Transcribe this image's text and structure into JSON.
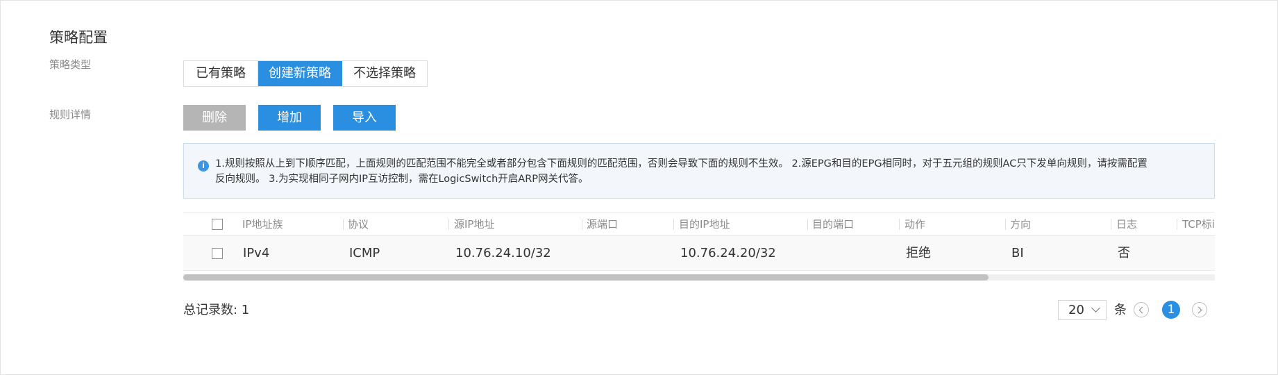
{
  "section_title": "策略配置",
  "policy_type": {
    "label": "策略类型",
    "options": [
      "已有策略",
      "创建新策略",
      "不选择策略"
    ],
    "selected": "创建新策略"
  },
  "rule_details": {
    "label": "规则详情",
    "buttons": {
      "delete": "删除",
      "add": "增加",
      "import": "导入"
    }
  },
  "notice": {
    "icon": "info-icon",
    "line1": "1.规则按照从上到下顺序匹配，上面规则的匹配范围不能完全或者部分包含下面规则的匹配范围，否则会导致下面的规则不生效。 2.源EPG和目的EPG相同时，对于五元组的规则AC只下发单向规则，请按需配置",
    "line2": "反向规则。 3.为实现相同子网内IP互访控制，需在LogicSwitch开启ARP网关代答。"
  },
  "table": {
    "columns": [
      "IP地址族",
      "协议",
      "源IP地址",
      "源端口",
      "目的IP地址",
      "目的端口",
      "动作",
      "方向",
      "日志",
      "TCP标i"
    ],
    "rows": [
      {
        "ip_family": "IPv4",
        "protocol": "ICMP",
        "src_ip": "10.76.24.10/32",
        "src_port": "",
        "dst_ip": "10.76.24.20/32",
        "dst_port": "",
        "action": "拒绝",
        "direction": "BI",
        "log": "否",
        "tcp_flag": ""
      }
    ]
  },
  "footer": {
    "total_label": "总记录数: 1",
    "page_size": "20",
    "page_size_unit": "条",
    "current_page": "1"
  },
  "colors": {
    "accent": "#2a8ee1",
    "disabled_button": "#b5b5b5",
    "notice_bg": "#f3f7fb"
  }
}
